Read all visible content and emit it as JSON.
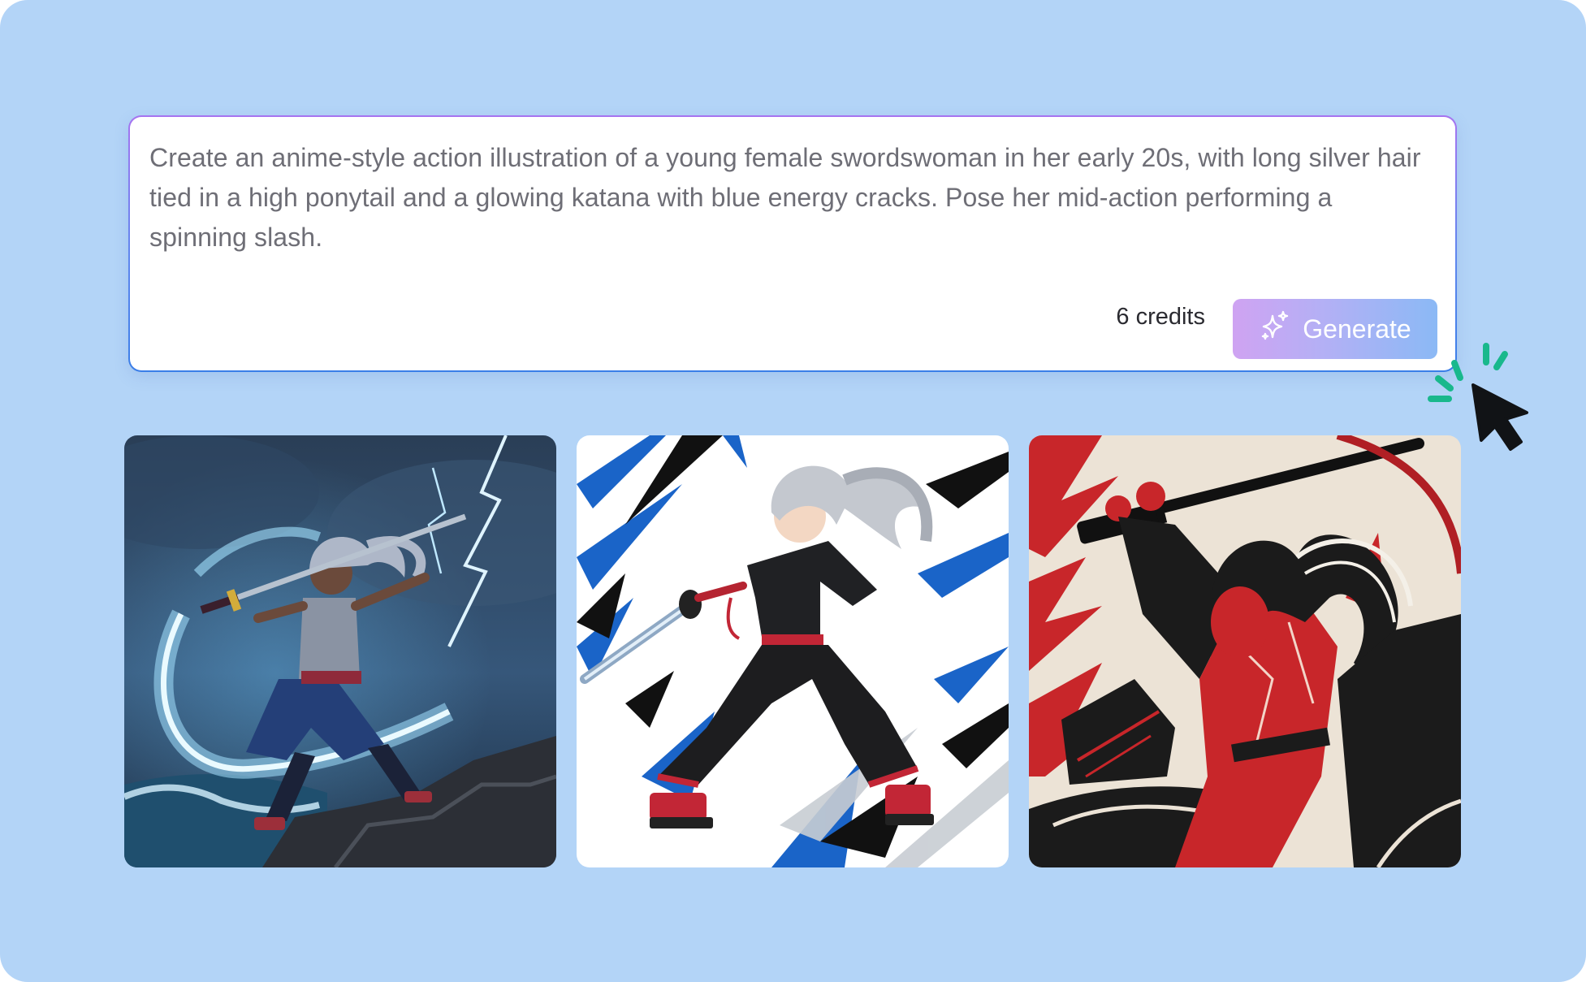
{
  "prompt": {
    "text": "Create an anime-style action illustration of a young female swordswoman in her early 20s, with long silver hair tied in a high ponytail and a glowing katana with blue energy cracks. Pose her mid-action performing a spinning slash."
  },
  "footer": {
    "credits_label": "6 credits",
    "generate_label": "Generate"
  },
  "icons": {
    "generate": "sparkles-icon",
    "cursor": "arrow-cursor-icon",
    "click_effect": "click-burst-icon"
  },
  "colors": {
    "background": "#b3d4f7",
    "button_gradient_start": "#cfa3f2",
    "button_gradient_end": "#8bb9f5",
    "click_burst": "#19b88c",
    "border_accent": "#a774f0"
  },
  "results": [
    {
      "style": "lightning storm"
    },
    {
      "style": "manga ink"
    },
    {
      "style": "red linocut"
    }
  ]
}
